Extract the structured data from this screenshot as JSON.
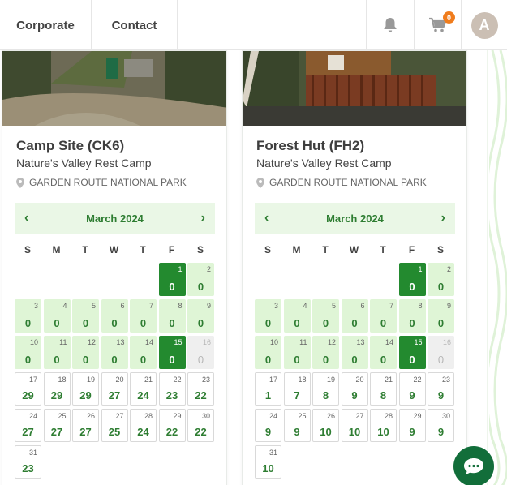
{
  "nav": {
    "corporate": "Corporate",
    "contact": "Contact"
  },
  "header": {
    "cart_count": "0",
    "avatar_initial": "A"
  },
  "weekdays": [
    "S",
    "M",
    "T",
    "W",
    "T",
    "F",
    "S"
  ],
  "cards": [
    {
      "title": "Camp Site (CK6)",
      "subtitle": "Nature's Valley Rest Camp",
      "park": "GARDEN ROUTE NATIONAL PARK",
      "month": "March 2024",
      "days": [
        {
          "d": "1",
          "a": "0",
          "s": "dark"
        },
        {
          "d": "2",
          "a": "0",
          "s": "light"
        },
        {
          "d": "3",
          "a": "0",
          "s": "light"
        },
        {
          "d": "4",
          "a": "0",
          "s": "light"
        },
        {
          "d": "5",
          "a": "0",
          "s": "light"
        },
        {
          "d": "6",
          "a": "0",
          "s": "light"
        },
        {
          "d": "7",
          "a": "0",
          "s": "light"
        },
        {
          "d": "8",
          "a": "0",
          "s": "light"
        },
        {
          "d": "9",
          "a": "0",
          "s": "light"
        },
        {
          "d": "10",
          "a": "0",
          "s": "light"
        },
        {
          "d": "11",
          "a": "0",
          "s": "light"
        },
        {
          "d": "12",
          "a": "0",
          "s": "light"
        },
        {
          "d": "13",
          "a": "0",
          "s": "light"
        },
        {
          "d": "14",
          "a": "0",
          "s": "light"
        },
        {
          "d": "15",
          "a": "0",
          "s": "dark"
        },
        {
          "d": "16",
          "a": "0",
          "s": "grey"
        },
        {
          "d": "17",
          "a": "29",
          "s": "white"
        },
        {
          "d": "18",
          "a": "29",
          "s": "white"
        },
        {
          "d": "19",
          "a": "29",
          "s": "white"
        },
        {
          "d": "20",
          "a": "27",
          "s": "white"
        },
        {
          "d": "21",
          "a": "24",
          "s": "white"
        },
        {
          "d": "22",
          "a": "23",
          "s": "white"
        },
        {
          "d": "23",
          "a": "22",
          "s": "white"
        },
        {
          "d": "24",
          "a": "27",
          "s": "white"
        },
        {
          "d": "25",
          "a": "27",
          "s": "white"
        },
        {
          "d": "26",
          "a": "27",
          "s": "white"
        },
        {
          "d": "27",
          "a": "25",
          "s": "white"
        },
        {
          "d": "28",
          "a": "24",
          "s": "white"
        },
        {
          "d": "29",
          "a": "22",
          "s": "white"
        },
        {
          "d": "30",
          "a": "22",
          "s": "white"
        },
        {
          "d": "31",
          "a": "23",
          "s": "white"
        }
      ]
    },
    {
      "title": "Forest Hut (FH2)",
      "subtitle": "Nature's Valley Rest Camp",
      "park": "GARDEN ROUTE NATIONAL PARK",
      "month": "March 2024",
      "days": [
        {
          "d": "1",
          "a": "0",
          "s": "dark"
        },
        {
          "d": "2",
          "a": "0",
          "s": "light"
        },
        {
          "d": "3",
          "a": "0",
          "s": "light"
        },
        {
          "d": "4",
          "a": "0",
          "s": "light"
        },
        {
          "d": "5",
          "a": "0",
          "s": "light"
        },
        {
          "d": "6",
          "a": "0",
          "s": "light"
        },
        {
          "d": "7",
          "a": "0",
          "s": "light"
        },
        {
          "d": "8",
          "a": "0",
          "s": "light"
        },
        {
          "d": "9",
          "a": "0",
          "s": "light"
        },
        {
          "d": "10",
          "a": "0",
          "s": "light"
        },
        {
          "d": "11",
          "a": "0",
          "s": "light"
        },
        {
          "d": "12",
          "a": "0",
          "s": "light"
        },
        {
          "d": "13",
          "a": "0",
          "s": "light"
        },
        {
          "d": "14",
          "a": "0",
          "s": "light"
        },
        {
          "d": "15",
          "a": "0",
          "s": "dark"
        },
        {
          "d": "16",
          "a": "0",
          "s": "grey"
        },
        {
          "d": "17",
          "a": "1",
          "s": "white"
        },
        {
          "d": "18",
          "a": "7",
          "s": "white"
        },
        {
          "d": "19",
          "a": "8",
          "s": "white"
        },
        {
          "d": "20",
          "a": "9",
          "s": "white"
        },
        {
          "d": "21",
          "a": "8",
          "s": "white"
        },
        {
          "d": "22",
          "a": "9",
          "s": "white"
        },
        {
          "d": "23",
          "a": "9",
          "s": "white"
        },
        {
          "d": "24",
          "a": "9",
          "s": "white"
        },
        {
          "d": "25",
          "a": "9",
          "s": "white"
        },
        {
          "d": "26",
          "a": "10",
          "s": "white"
        },
        {
          "d": "27",
          "a": "10",
          "s": "white"
        },
        {
          "d": "28",
          "a": "10",
          "s": "white"
        },
        {
          "d": "29",
          "a": "9",
          "s": "white"
        },
        {
          "d": "30",
          "a": "9",
          "s": "white"
        },
        {
          "d": "31",
          "a": "10",
          "s": "white"
        }
      ]
    }
  ],
  "colors": {
    "brand_green": "#238a2f",
    "light_green": "#dff5d6",
    "cart_badge": "#f07c1c",
    "chat": "#126e3a"
  }
}
